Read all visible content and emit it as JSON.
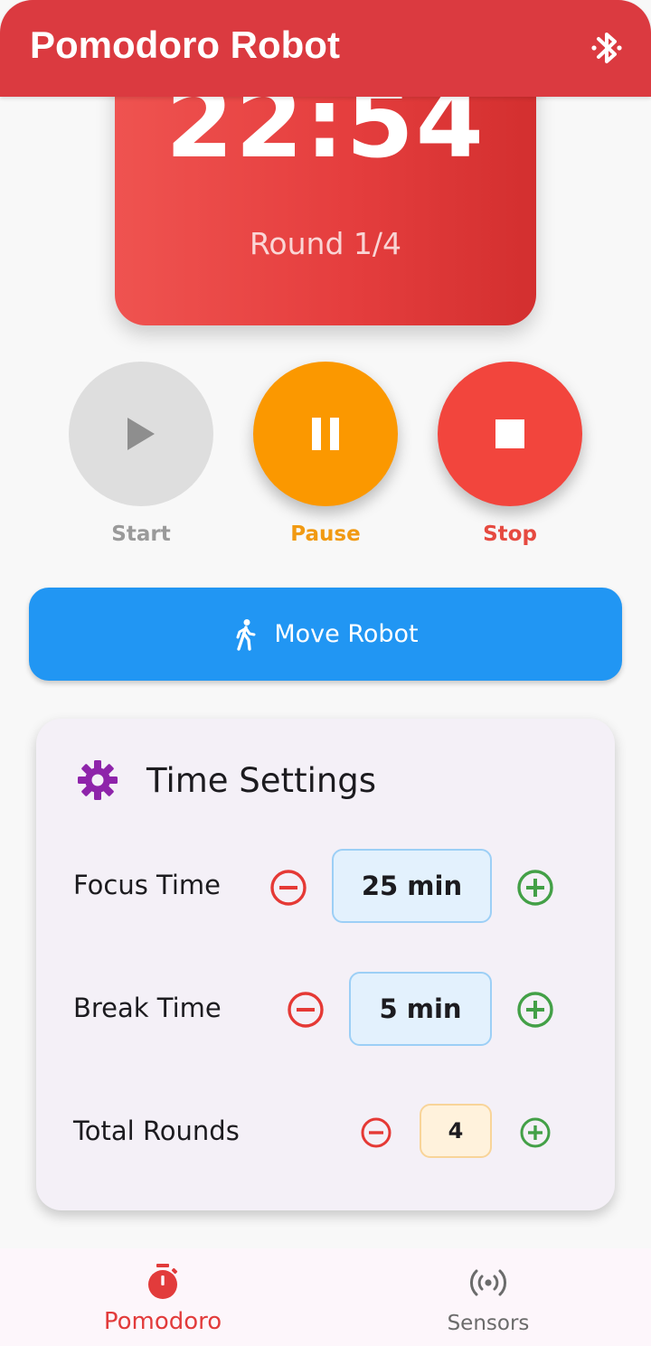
{
  "header": {
    "title": "Pomodoro Robot",
    "bluetooth_icon": "bluetooth-icon"
  },
  "timer": {
    "time": "22:54",
    "round": "Round 1/4"
  },
  "controls": {
    "start_label": "Start",
    "pause_label": "Pause",
    "stop_label": "Stop"
  },
  "move_robot": {
    "label": "Move Robot",
    "icon": "walk-icon"
  },
  "settings": {
    "title": "Time Settings",
    "icon": "gear-icon",
    "rows": [
      {
        "label": "Focus Time",
        "value": "25 min"
      },
      {
        "label": "Break Time",
        "value": "5 min"
      },
      {
        "label": "Total Rounds",
        "value": "4"
      }
    ]
  },
  "bottom_nav": {
    "items": [
      {
        "label": "Pomodoro",
        "icon": "timer-icon",
        "active": true
      },
      {
        "label": "Sensors",
        "icon": "sensors-icon",
        "active": false
      }
    ]
  },
  "colors": {
    "header": "#db3a40",
    "timer_card": "#e53e3e",
    "pause": "#fb9800",
    "stop": "#f2453d",
    "move_robot": "#2196f3",
    "minus": "#e53935",
    "plus": "#43a047",
    "settings_icon": "#8e24aa"
  }
}
